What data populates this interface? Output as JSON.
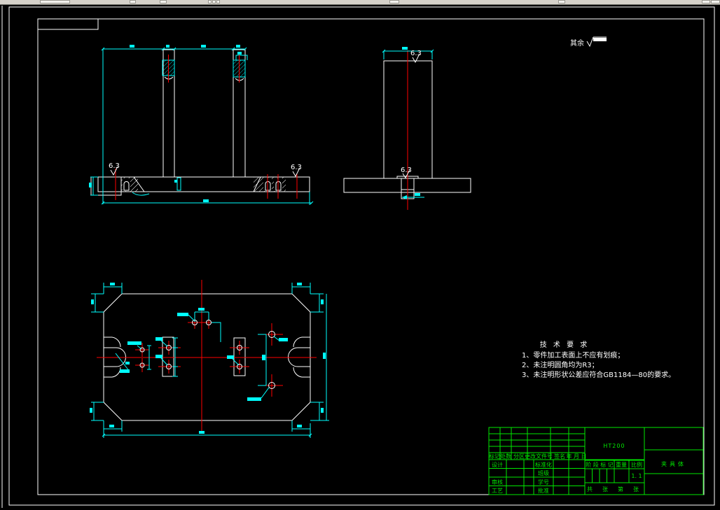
{
  "annotations": {
    "rest_label": "其余",
    "roughness": "6.3"
  },
  "tech": {
    "title": "技 术 要 求",
    "items": [
      "1、零件加工表面上不应有划痕；",
      "2、未注明圆角均为R3；",
      "3、未注明形状公差应符合GB1184—80的要求。"
    ]
  },
  "title_block": {
    "material": "HT200",
    "part_name": "夹具体",
    "header": [
      "标记",
      "处数",
      "分区",
      "更改文件号",
      "签名",
      "年 月 日"
    ],
    "design_label": "设计",
    "standard_label": "标准化",
    "class_label": "班级",
    "check_label": "审核",
    "studentno_label": "学号",
    "process_label": "工艺",
    "approve_label": "批准",
    "stage_label": "阶 段 标 记",
    "weight_label": "重量",
    "scale_label": "比例",
    "scale_value": "1. 1",
    "sheet_total_label": "共",
    "sheet_unit1": "张",
    "sheet_index_label": "第",
    "sheet_unit2": "张"
  },
  "colors": {
    "background": "#000000",
    "lines": "#ffffff",
    "dimensions": "#00ffff",
    "centerlines": "#ff0000",
    "titleblock": "#00e800"
  }
}
